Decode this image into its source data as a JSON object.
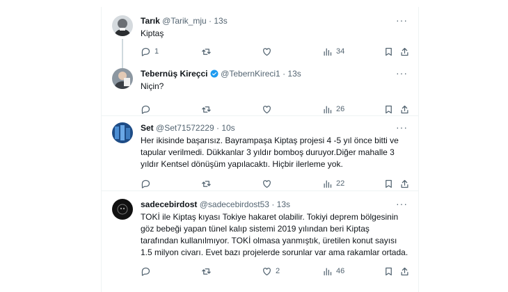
{
  "tweets": [
    {
      "name": "Tarık",
      "handle": "@Tarik_mju",
      "sep": "·",
      "time": "13s",
      "text": "Kiptaş",
      "replies": "",
      "reply_count": "1",
      "retweets": "",
      "likes": "",
      "views": "34",
      "verified": false,
      "avatar_color": "#c9ced3"
    },
    {
      "name": "Tebernüş Kireçci",
      "handle": "@TebernKireci1",
      "sep": "·",
      "time": "13s",
      "text": "Niçin?",
      "reply_count": "",
      "retweets": "",
      "likes": "",
      "views": "26",
      "verified": true,
      "avatar_color": "#7d8a96"
    },
    {
      "name": "Set",
      "handle": "@Set71572229",
      "sep": "·",
      "time": "10s",
      "text": "Her ikisinde başarısız. Bayrampaşa Kiptaş projesi 4 -5 yıl önce bitti ve tapular verilmedi. Dükkanlar 3 yıldır bomboş duruyor.Diğer mahalle 3 yıldır Kentsel dönüşüm yapılacaktı. Hiçbir ilerleme yok.",
      "reply_count": "",
      "retweets": "",
      "likes": "",
      "views": "22",
      "verified": false,
      "avatar_color": "#2c5f9e"
    },
    {
      "name": "sadecebirdost",
      "handle": "@sadecebirdost53",
      "sep": "·",
      "time": "13s",
      "text": "TOKİ ile Kiptaş kıyası Tokiye hakaret olabilir. Tokiyi deprem bölgesinin göz bebeği yapan tünel kalıp sistemi 2019 yılından beri Kiptaş tarafından kullanılmıyor. TOKİ olmasa yanmıştık, üretilen konut sayısı 1.5 milyon civarı. Evet bazı projelerde sorunlar var ama rakamlar ortada.",
      "reply_count": "",
      "retweets": "",
      "likes": "2",
      "views": "46",
      "verified": false,
      "avatar_color": "#111111"
    }
  ],
  "more_label": "···",
  "colors": {
    "accent": "#1d9bf0",
    "muted": "#536471",
    "border": "#eff3f4"
  }
}
